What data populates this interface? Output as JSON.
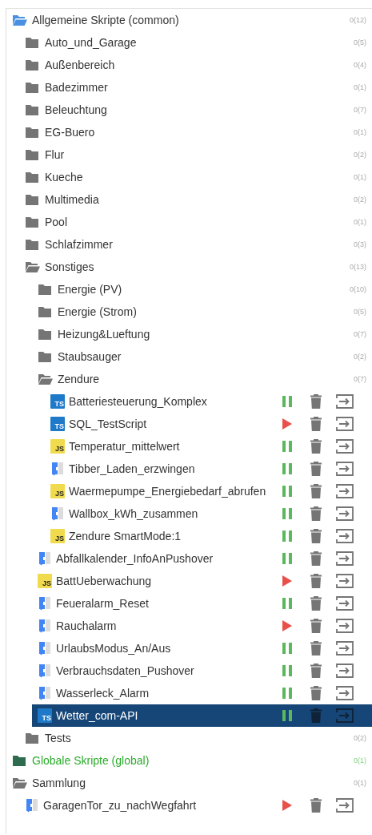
{
  "tree": [
    {
      "kind": "folder",
      "name": "Allgemeine Skripte (common)",
      "count": "0(12)",
      "expanded": true,
      "selected": false,
      "color": "#4a90e2",
      "children": [
        {
          "kind": "folder",
          "name": "Auto_und_Garage",
          "count": "0(5)",
          "expanded": false,
          "selected": false,
          "color": "#757575"
        },
        {
          "kind": "folder",
          "name": "Außenbereich",
          "count": "0(4)",
          "expanded": false,
          "selected": false,
          "color": "#757575"
        },
        {
          "kind": "folder",
          "name": "Badezimmer",
          "count": "0(1)",
          "expanded": false,
          "selected": false,
          "color": "#757575"
        },
        {
          "kind": "folder",
          "name": "Beleuchtung",
          "count": "0(7)",
          "expanded": false,
          "selected": false,
          "color": "#757575"
        },
        {
          "kind": "folder",
          "name": "EG-Buero",
          "count": "0(1)",
          "expanded": false,
          "selected": false,
          "color": "#757575"
        },
        {
          "kind": "folder",
          "name": "Flur",
          "count": "0(2)",
          "expanded": false,
          "selected": false,
          "color": "#757575"
        },
        {
          "kind": "folder",
          "name": "Kueche",
          "count": "0(1)",
          "expanded": false,
          "selected": false,
          "color": "#757575"
        },
        {
          "kind": "folder",
          "name": "Multimedia",
          "count": "0(2)",
          "expanded": false,
          "selected": false,
          "color": "#757575"
        },
        {
          "kind": "folder",
          "name": "Pool",
          "count": "0(1)",
          "expanded": false,
          "selected": false,
          "color": "#757575"
        },
        {
          "kind": "folder",
          "name": "Schlafzimmer",
          "count": "0(3)",
          "expanded": false,
          "selected": false,
          "color": "#757575"
        },
        {
          "kind": "folder",
          "name": "Sonstiges",
          "count": "0(13)",
          "expanded": true,
          "selected": false,
          "color": "#757575",
          "children": [
            {
              "kind": "folder",
              "name": "Energie (PV)",
              "count": "0(10)",
              "expanded": false,
              "selected": false,
              "color": "#757575"
            },
            {
              "kind": "folder",
              "name": "Energie (Strom)",
              "count": "0(5)",
              "expanded": false,
              "selected": false,
              "color": "#757575"
            },
            {
              "kind": "folder",
              "name": "Heizung&Lueftung",
              "count": "0(7)",
              "expanded": false,
              "selected": false,
              "color": "#757575"
            },
            {
              "kind": "folder",
              "name": "Staubsauger",
              "count": "0(2)",
              "expanded": false,
              "selected": false,
              "color": "#757575"
            },
            {
              "kind": "folder",
              "name": "Zendure",
              "count": "0(7)",
              "expanded": true,
              "selected": false,
              "color": "#757575",
              "children": [
                {
                  "kind": "ts",
                  "badge": "TS",
                  "name": "Batteriesteuerung_Komplex",
                  "running": true,
                  "selected": false
                },
                {
                  "kind": "ts",
                  "badge": "TS",
                  "name": "SQL_TestScript",
                  "running": false,
                  "selected": false
                },
                {
                  "kind": "js",
                  "badge": "JS",
                  "name": "Temperatur_mittelwert",
                  "running": true,
                  "selected": false
                },
                {
                  "kind": "blockly",
                  "name": "Tibber_Laden_erzwingen",
                  "running": true,
                  "selected": false
                },
                {
                  "kind": "js",
                  "badge": "JS",
                  "name": "Waermepumpe_Energiebedarf_abrufen",
                  "running": true,
                  "selected": false
                },
                {
                  "kind": "blockly",
                  "name": "Wallbox_kWh_zusammen",
                  "running": true,
                  "selected": false
                },
                {
                  "kind": "js",
                  "badge": "JS",
                  "name": "Zendure SmartMode:1",
                  "running": true,
                  "selected": false
                }
              ]
            },
            {
              "kind": "blockly",
              "name": "Abfallkalender_InfoAnPushover",
              "running": true,
              "selected": false
            },
            {
              "kind": "js",
              "badge": "JS",
              "name": "BattUeberwachung",
              "running": false,
              "selected": false
            },
            {
              "kind": "blockly",
              "name": "Feueralarm_Reset",
              "running": true,
              "selected": false
            },
            {
              "kind": "blockly",
              "name": "Rauchalarm",
              "running": false,
              "selected": false
            },
            {
              "kind": "blockly",
              "name": "UrlaubsModus_An/Aus",
              "running": true,
              "selected": false
            },
            {
              "kind": "blockly",
              "name": "Verbrauchsdaten_Pushover",
              "running": true,
              "selected": false
            },
            {
              "kind": "blockly",
              "name": "Wasserleck_Alarm",
              "running": true,
              "selected": false
            },
            {
              "kind": "ts",
              "badge": "TS",
              "name": "Wetter_com-API",
              "running": true,
              "selected": true
            }
          ]
        },
        {
          "kind": "folder",
          "name": "Tests",
          "count": "0(2)",
          "expanded": false,
          "selected": false,
          "color": "#757575"
        }
      ]
    },
    {
      "kind": "global",
      "name": "Globale Skripte (global)",
      "count": "0(1)",
      "expanded": false,
      "selected": false,
      "color": "#2f6b4f"
    },
    {
      "kind": "folder",
      "name": "Sammlung",
      "count": "0(1)",
      "expanded": true,
      "selected": false,
      "color": "#757575",
      "children": [
        {
          "kind": "blockly",
          "name": "GaragenTor_zu_nachWegfahrt",
          "running": false,
          "selected": false
        }
      ]
    }
  ]
}
